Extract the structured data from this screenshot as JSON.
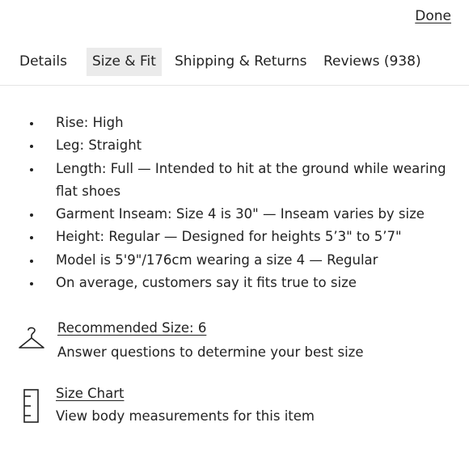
{
  "header": {
    "done_label": "Done"
  },
  "tabs": [
    {
      "label": "Details",
      "active": false
    },
    {
      "label": "Size & Fit",
      "active": true
    },
    {
      "label": "Shipping & Returns",
      "active": false
    },
    {
      "label": "Reviews (938)",
      "active": false
    }
  ],
  "fit_details": [
    "Rise: High",
    "Leg: Straight",
    "Length: Full — Intended to hit at the ground while wearing flat shoes",
    "Garment Inseam: Size 4 is 30\" — Inseam varies by size",
    "Height: Regular — Designed for heights 5’3\" to 5’7\"",
    "Model is 5'9\"/176cm wearing a size 4  —  Regular",
    "On average, customers say it fits true to size"
  ],
  "recommended_size": {
    "icon": "hanger-icon",
    "title": "Recommended Size: 6",
    "subtitle": "Answer questions to determine your best size"
  },
  "size_chart": {
    "icon": "ruler-icon",
    "title": "Size Chart",
    "subtitle": "View body measurements for this item"
  },
  "colors": {
    "text": "#222222",
    "active_tab_bg": "#ebebeb",
    "divider": "#e4e4e4"
  }
}
